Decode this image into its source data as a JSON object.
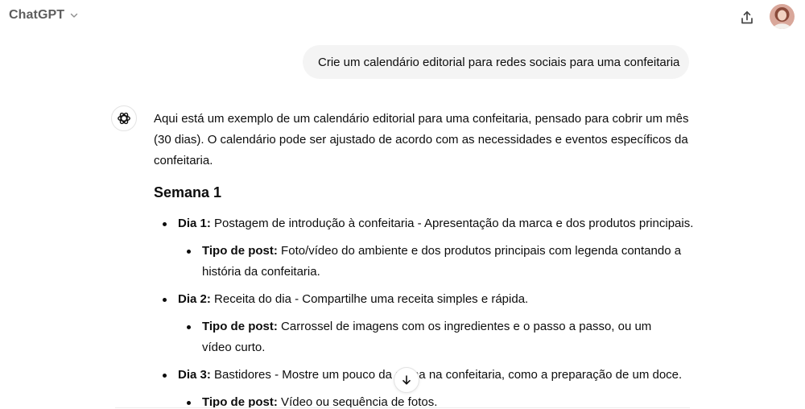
{
  "header": {
    "model_name": "ChatGPT"
  },
  "icons": {
    "chevron": "chevron-down-icon",
    "share": "share-icon",
    "openai": "openai-logo-icon",
    "scroll": "arrow-down-icon"
  },
  "user_message": "Crie um calendário editorial para redes sociais para uma confeitaria",
  "assistant": {
    "intro": "Aqui está um exemplo de um calendário editorial para uma confeitaria, pensado para cobrir um mês (30 dias). O calendário pode ser ajustado de acordo com as necessidades e eventos específicos da confeitaria.",
    "week_title": "Semana 1",
    "days": [
      {
        "label": "Dia 1:",
        "text": " Postagem de introdução à confeitaria - Apresentação da marca e dos produtos principais.",
        "post_label": "Tipo de post:",
        "post_text": " Foto/vídeo do ambiente e dos produtos principais com legenda contando a história da confeitaria."
      },
      {
        "label": "Dia 2:",
        "text": " Receita do dia - Compartilhe uma receita simples e rápida.",
        "post_label": "Tipo de post:",
        "post_text": " Carrossel de imagens com os ingredientes e o passo a passo, ou um vídeo curto."
      },
      {
        "label": "Dia 3:",
        "text": " Bastidores - Mostre um pouco da rotina na confeitaria, como a preparação de um doce.",
        "post_label": "Tipo de post:",
        "post_text": " Vídeo ou sequência de fotos."
      }
    ]
  },
  "colors": {
    "bubble_bg": "#f4f4f4",
    "text": "#0d0d0d",
    "muted": "#5d5d5d"
  }
}
